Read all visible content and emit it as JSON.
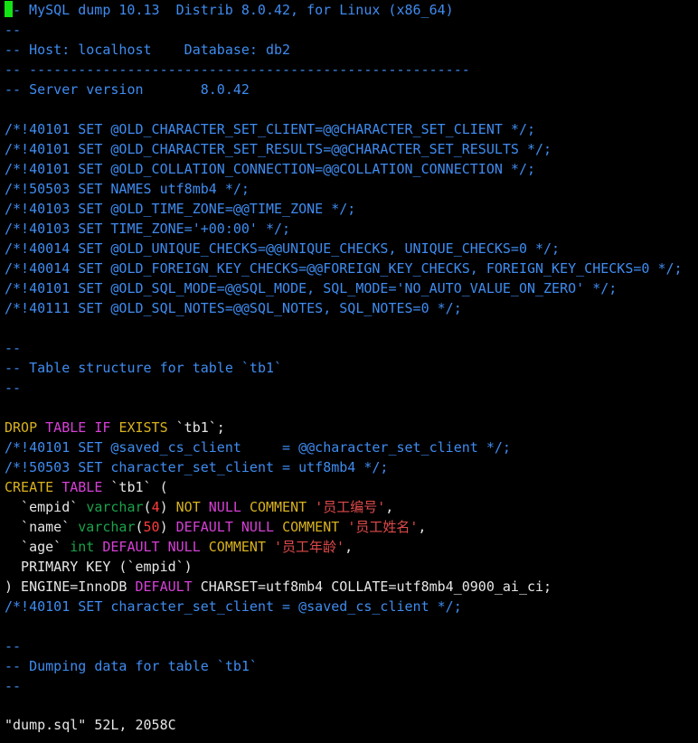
{
  "editor": {
    "lines": [
      [
        {
          "c": "cursor",
          "t": ""
        },
        {
          "c": "c-comment",
          "t": "- MySQL dump 10.13  Distrib 8.0.42, for Linux (x86_64)"
        }
      ],
      [
        {
          "c": "c-comment",
          "t": "--"
        }
      ],
      [
        {
          "c": "c-comment",
          "t": "-- Host: localhost    Database: db2"
        }
      ],
      [
        {
          "c": "c-comment",
          "t": "-- ------------------------------------------------------"
        }
      ],
      [
        {
          "c": "c-comment",
          "t": "-- Server version\t8.0.42"
        }
      ],
      [],
      [
        {
          "c": "c-comment",
          "t": "/*!40101 SET @OLD_CHARACTER_SET_CLIENT=@@CHARACTER_SET_CLIENT */;"
        }
      ],
      [
        {
          "c": "c-comment",
          "t": "/*!40101 SET @OLD_CHARACTER_SET_RESULTS=@@CHARACTER_SET_RESULTS */;"
        }
      ],
      [
        {
          "c": "c-comment",
          "t": "/*!40101 SET @OLD_COLLATION_CONNECTION=@@COLLATION_CONNECTION */;"
        }
      ],
      [
        {
          "c": "c-comment",
          "t": "/*!50503 SET NAMES utf8mb4 */;"
        }
      ],
      [
        {
          "c": "c-comment",
          "t": "/*!40103 SET @OLD_TIME_ZONE=@@TIME_ZONE */;"
        }
      ],
      [
        {
          "c": "c-comment",
          "t": "/*!40103 SET TIME_ZONE='+00:00' */;"
        }
      ],
      [
        {
          "c": "c-comment",
          "t": "/*!40014 SET @OLD_UNIQUE_CHECKS=@@UNIQUE_CHECKS, UNIQUE_CHECKS=0 */;"
        }
      ],
      [
        {
          "c": "c-comment",
          "t": "/*!40014 SET @OLD_FOREIGN_KEY_CHECKS=@@FOREIGN_KEY_CHECKS, FOREIGN_KEY_CHECKS=0 */;"
        }
      ],
      [
        {
          "c": "c-comment",
          "t": "/*!40101 SET @OLD_SQL_MODE=@@SQL_MODE, SQL_MODE='NO_AUTO_VALUE_ON_ZERO' */;"
        }
      ],
      [
        {
          "c": "c-comment",
          "t": "/*!40111 SET @OLD_SQL_NOTES=@@SQL_NOTES, SQL_NOTES=0 */;"
        }
      ],
      [],
      [
        {
          "c": "c-comment",
          "t": "--"
        }
      ],
      [
        {
          "c": "c-comment",
          "t": "-- Table structure for table `tb1`"
        }
      ],
      [
        {
          "c": "c-comment",
          "t": "--"
        }
      ],
      [],
      [
        {
          "c": "c-kw2",
          "t": "DROP"
        },
        {
          "c": "c-plain",
          "t": " "
        },
        {
          "c": "c-kw",
          "t": "TABLE"
        },
        {
          "c": "c-plain",
          "t": " "
        },
        {
          "c": "c-kw",
          "t": "IF"
        },
        {
          "c": "c-plain",
          "t": " "
        },
        {
          "c": "c-kw2",
          "t": "EXISTS"
        },
        {
          "c": "c-plain",
          "t": " `tb1`;"
        }
      ],
      [
        {
          "c": "c-comment",
          "t": "/*!40101 SET @saved_cs_client     = @@character_set_client */;"
        }
      ],
      [
        {
          "c": "c-comment",
          "t": "/*!50503 SET character_set_client = utf8mb4 */;"
        }
      ],
      [
        {
          "c": "c-kw2",
          "t": "CREATE"
        },
        {
          "c": "c-plain",
          "t": " "
        },
        {
          "c": "c-kw",
          "t": "TABLE"
        },
        {
          "c": "c-plain",
          "t": " `tb1` ("
        }
      ],
      [
        {
          "c": "c-plain",
          "t": "  `empid` "
        },
        {
          "c": "c-type",
          "t": "varchar"
        },
        {
          "c": "c-plain",
          "t": "("
        },
        {
          "c": "c-num",
          "t": "4"
        },
        {
          "c": "c-plain",
          "t": ") "
        },
        {
          "c": "c-kw2",
          "t": "NOT"
        },
        {
          "c": "c-plain",
          "t": " "
        },
        {
          "c": "c-kw",
          "t": "NULL"
        },
        {
          "c": "c-plain",
          "t": " "
        },
        {
          "c": "c-kw2",
          "t": "COMMENT"
        },
        {
          "c": "c-plain",
          "t": " "
        },
        {
          "c": "c-str",
          "t": "'员工编号'"
        },
        {
          "c": "c-plain",
          "t": ","
        }
      ],
      [
        {
          "c": "c-plain",
          "t": "  `name` "
        },
        {
          "c": "c-type",
          "t": "varchar"
        },
        {
          "c": "c-plain",
          "t": "("
        },
        {
          "c": "c-num",
          "t": "50"
        },
        {
          "c": "c-plain",
          "t": ") "
        },
        {
          "c": "c-kw",
          "t": "DEFAULT"
        },
        {
          "c": "c-plain",
          "t": " "
        },
        {
          "c": "c-kw",
          "t": "NULL"
        },
        {
          "c": "c-plain",
          "t": " "
        },
        {
          "c": "c-kw2",
          "t": "COMMENT"
        },
        {
          "c": "c-plain",
          "t": " "
        },
        {
          "c": "c-str",
          "t": "'员工姓名'"
        },
        {
          "c": "c-plain",
          "t": ","
        }
      ],
      [
        {
          "c": "c-plain",
          "t": "  `age` "
        },
        {
          "c": "c-type",
          "t": "int"
        },
        {
          "c": "c-plain",
          "t": " "
        },
        {
          "c": "c-kw",
          "t": "DEFAULT"
        },
        {
          "c": "c-plain",
          "t": " "
        },
        {
          "c": "c-kw",
          "t": "NULL"
        },
        {
          "c": "c-plain",
          "t": " "
        },
        {
          "c": "c-kw2",
          "t": "COMMENT"
        },
        {
          "c": "c-plain",
          "t": " "
        },
        {
          "c": "c-str",
          "t": "'员工年龄'"
        },
        {
          "c": "c-plain",
          "t": ","
        }
      ],
      [
        {
          "c": "c-plain",
          "t": "  PRIMARY KEY (`empid`)"
        }
      ],
      [
        {
          "c": "c-plain",
          "t": ") ENGINE=InnoDB "
        },
        {
          "c": "c-kw",
          "t": "DEFAULT"
        },
        {
          "c": "c-plain",
          "t": " CHARSET=utf8mb4 COLLATE=utf8mb4_0900_ai_ci;"
        }
      ],
      [
        {
          "c": "c-comment",
          "t": "/*!40101 SET character_set_client = @saved_cs_client */;"
        }
      ],
      [],
      [
        {
          "c": "c-comment",
          "t": "--"
        }
      ],
      [
        {
          "c": "c-comment",
          "t": "-- Dumping data for table `tb1`"
        }
      ],
      [
        {
          "c": "c-comment",
          "t": "--"
        }
      ]
    ]
  },
  "status": {
    "text": "\"dump.sql\" 52L, 2058C"
  },
  "colors": {
    "background": "#000000",
    "comment": "#3f8cf0",
    "keyword": "#d640d6",
    "keyword_alt": "#d9b21f",
    "type": "#1aa34a",
    "number": "#ff3c3c",
    "string": "#e04a4a",
    "cursor": "#13e313"
  }
}
